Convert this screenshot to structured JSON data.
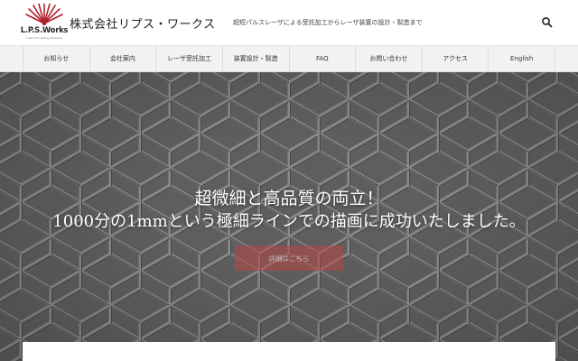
{
  "brand": {
    "logo_text": "L.P.S.Works",
    "logo_tagline": "Laser Processing Solutions",
    "company_name": "株式会社リプス・ワークス",
    "tagline": "超短パルスレーザによる受託加工からレーザ装置の設計・製造まで",
    "accent_color": "#b0202a"
  },
  "header": {
    "search_icon": "search-icon"
  },
  "nav": {
    "items": [
      {
        "label": "お知らせ"
      },
      {
        "label": "会社案内"
      },
      {
        "label": "レーザ受託加工"
      },
      {
        "label": "装置設計・製造"
      },
      {
        "label": "FAQ"
      },
      {
        "label": "お問い合わせ"
      },
      {
        "label": "アクセス"
      },
      {
        "label": "English"
      }
    ]
  },
  "hero": {
    "title_line1": "超微細と高品質の両立！",
    "title_line2": "1000分の1mmという極細ラインでの描画に成功いたしました。",
    "button_label": "詳細はこちら",
    "button_color": "#b84646"
  }
}
